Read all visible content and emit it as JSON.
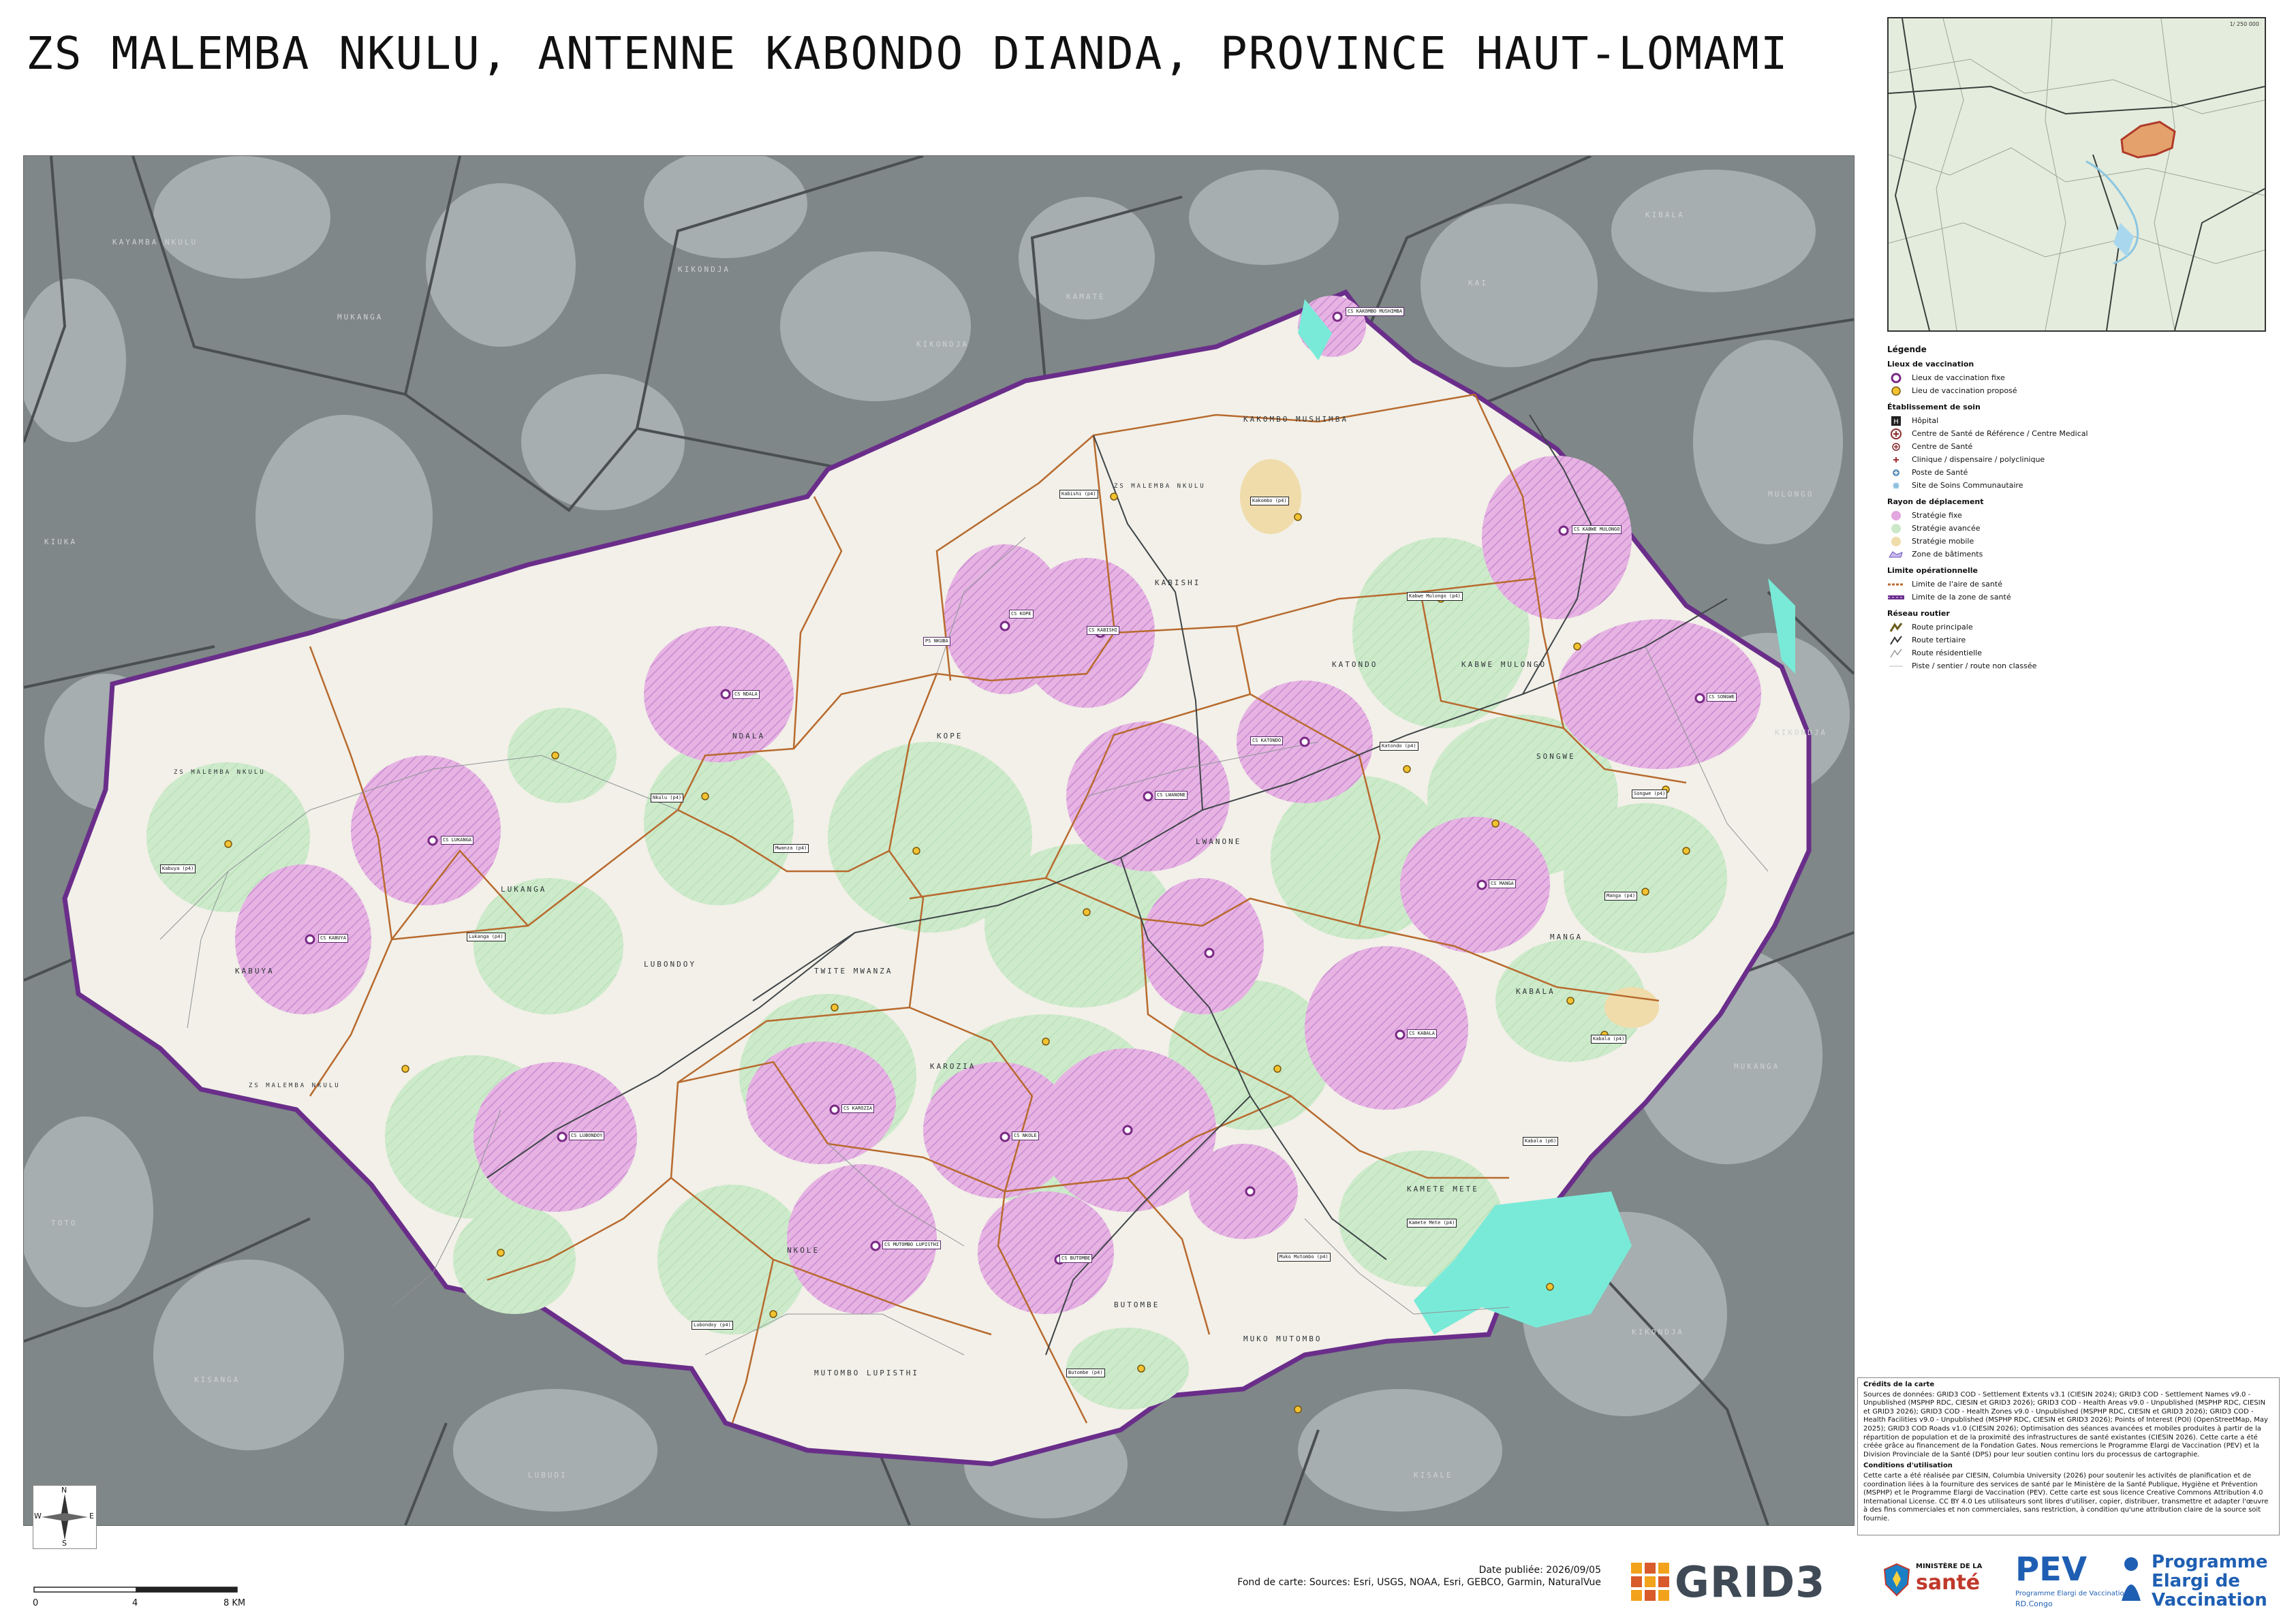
{
  "title": "ZS MALEMBA NKULU, ANTENNE KABONDO DIANDA, PROVINCE HAUT-LOMAMI",
  "colors": {
    "outside": "#7f8788",
    "settlement_outside": "#a9b1b3",
    "zone_bg": "#f1efe6",
    "fixed": "#e3a8df",
    "advanced": "#cbe9c9",
    "mobile": "#f0dcab",
    "water": "#79ead8",
    "boundary_area": "#b86a2e",
    "boundary_zone": "#6a2e8a"
  },
  "map": {
    "outside_labels": [
      "KAYAMBA NKULU",
      "MUKANGA",
      "KIKONDJA",
      "KIKONDJA",
      "KAMATE",
      "KIBALA",
      "MULONGO",
      "KIKONDJA",
      "MUKANGA",
      "KIKONDJA",
      "KISALE",
      "LUBUDI",
      "KISANGA",
      "TOTO",
      "KIUKA",
      "KAI"
    ],
    "aire_labels": [
      "KAKOMBO MUSHIMBA",
      "KABISHI",
      "KATONDO",
      "KABWE MULONGO",
      "SONGWE",
      "LWANONE",
      "MANGA",
      "KABALA",
      "NDALA",
      "KOPE",
      "LUKANGA",
      "KABUYA",
      "LUBONDOY",
      "TWITE MWANZA",
      "KAROZIA",
      "NKOLE",
      "BUTOMBE",
      "MUKO MUTOMBO",
      "KAMETE METE",
      "MUTOMBO LUPISTHI"
    ],
    "zone_boundary_labels": [
      "ZS MALEMBA NKULU",
      "ZS MALEMBA NKULU",
      "ZS MALEMBA NKULU"
    ],
    "sites": [
      {
        "label": "CS KAKOMBO MUSHIMBA",
        "kind": "fix"
      },
      {
        "label": "Kakombo (p4)",
        "kind": "adv"
      },
      {
        "label": "Kabishi (p4)",
        "kind": "adv"
      },
      {
        "label": "CS KABISHI",
        "kind": "fix"
      },
      {
        "label": "PS NKUBA",
        "kind": "fix"
      },
      {
        "label": "CS KOPE",
        "kind": "fix"
      },
      {
        "label": "CS NDALA",
        "kind": "fix"
      },
      {
        "label": "CS LUKANGA",
        "kind": "fix"
      },
      {
        "label": "CS KABUYA",
        "kind": "fix"
      },
      {
        "label": "CS KATONDO",
        "kind": "fix"
      },
      {
        "label": "CS LWANONE",
        "kind": "fix"
      },
      {
        "label": "CS MANGA",
        "kind": "fix"
      },
      {
        "label": "CS KABALA",
        "kind": "fix"
      },
      {
        "label": "CS LUBONDOY",
        "kind": "fix"
      },
      {
        "label": "CS KAROZIA",
        "kind": "fix"
      },
      {
        "label": "CS NKOLE",
        "kind": "fix"
      },
      {
        "label": "CS BUTOMBE",
        "kind": "fix"
      },
      {
        "label": "CS MUTOMBO LUPISTHI",
        "kind": "fix"
      },
      {
        "label": "CS SONGWE",
        "kind": "fix"
      },
      {
        "label": "CS KABWE MULONGO",
        "kind": "fix"
      },
      {
        "label": "Kabwe Mulongo (p4)",
        "kind": "adv"
      },
      {
        "label": "Nkulu (p4)",
        "kind": "adv"
      },
      {
        "label": "Kabuya (p4)",
        "kind": "adv"
      },
      {
        "label": "Lukanga (p4)",
        "kind": "adv"
      },
      {
        "label": "Mwanza (p4)",
        "kind": "adv"
      },
      {
        "label": "Songwe (p4)",
        "kind": "adv"
      },
      {
        "label": "Manga (p4)",
        "kind": "adv"
      },
      {
        "label": "Kabala (p4)",
        "kind": "adv"
      },
      {
        "label": "Kamete Mete (p4)",
        "kind": "adv"
      },
      {
        "label": "Muko Mutombo (p4)",
        "kind": "adv"
      },
      {
        "label": "Butombe (p4)",
        "kind": "adv"
      },
      {
        "label": "Lubondoy (p4)",
        "kind": "adv"
      },
      {
        "label": "Katondo (p4)",
        "kind": "adv"
      },
      {
        "label": "Kabala (p6)",
        "kind": "adv"
      }
    ]
  },
  "inset": {
    "scale": "1/ 250 000"
  },
  "legend": {
    "title": "Légende",
    "sections": [
      {
        "title": "Lieux de vaccination",
        "items": [
          {
            "label": "Lieux de vaccination fixe",
            "icon": "fixed-site-icon"
          },
          {
            "label": "Lieu de vaccination proposé",
            "icon": "proposed-site-icon"
          }
        ]
      },
      {
        "title": "Établissement de soin",
        "items": [
          {
            "label": "Hôpital",
            "icon": "hospital-icon"
          },
          {
            "label": "Centre de Santé de Référence / Centre Medical",
            "icon": "reference-center-icon"
          },
          {
            "label": "Centre de Santé",
            "icon": "health-center-icon"
          },
          {
            "label": "Clinique / dispensaire / polyclinique",
            "icon": "clinic-icon"
          },
          {
            "label": "Poste de Santé",
            "icon": "health-post-icon"
          },
          {
            "label": "Site de Soins Communautaire",
            "icon": "community-site-icon"
          }
        ]
      },
      {
        "title": "Rayon de déplacement",
        "items": [
          {
            "label": "Stratégie fixe",
            "icon": "fixed-strategy-icon"
          },
          {
            "label": "Stratégie avancée",
            "icon": "advanced-strategy-icon"
          },
          {
            "label": "Stratégie mobile",
            "icon": "mobile-strategy-icon"
          },
          {
            "label": "Zone de bâtiments",
            "icon": "buildings-zone-icon"
          }
        ]
      },
      {
        "title": "Limite opérationnelle",
        "items": [
          {
            "label": "Limite de l'aire de santé",
            "icon": "health-area-limit-icon"
          },
          {
            "label": "Limite de la zone de santé",
            "icon": "health-zone-limit-icon"
          }
        ]
      },
      {
        "title": "Réseau routier",
        "items": [
          {
            "label": "Route principale",
            "icon": "main-road-icon"
          },
          {
            "label": "Route tertiaire",
            "icon": "tertiary-road-icon"
          },
          {
            "label": "Route résidentielle",
            "icon": "residential-road-icon"
          },
          {
            "label": "Piste / sentier / route non classée",
            "icon": "track-icon"
          }
        ]
      }
    ]
  },
  "credits": {
    "title": "Crédits de la carte",
    "text": "Sources de données: GRID3 COD - Settlement Extents v3.1 (CIESIN 2024); GRID3 COD - Settlement Names v9.0 - Unpublished (MSPHP RDC, CIESIN et GRID3 2026); GRID3 COD - Health Areas v9.0 - Unpublished (MSPHP RDC, CIESIN et GRID3 2026); GRID3 COD - Health Zones v9.0 - Unpublished (MSPHP RDC, CIESIN et GRID3 2026); GRID3 COD - Health Facilities v9.0 - Unpublished (MSPHP RDC, CIESIN et GRID3 2026); Points of Interest (POI) (OpenStreetMap, May 2025); GRID3 COD Roads v1.0 (CIESIN 2026); Optimisation des séances avancées et mobiles produites à partir de la répartition de population et de la proximité des infrastructures de santé existantes (CIESIN 2026). Cette carte a été créée grâce au financement de la Fondation Gates. Nous remercions le Programme Elargi de Vaccination (PEV) et la Division Provinciale de la Santé (DPS) pour leur soutien continu lors du processus de cartographie.",
    "terms_title": "Conditions d'utilisation",
    "terms": "Cette carte a été réalisée par CIESIN, Columbia University (2026) pour soutenir les activités de planification et de coordination liées à la fourniture des services de santé par le Ministère de la Santé Publique, Hygiène et Prévention (MSPHP) et le Programme Elargi de Vaccination (PEV). Cette carte est sous licence Creative Commons Attribution 4.0 International License. CC BY 4.0 Les utilisateurs sont libres d'utiliser, copier, distribuer, transmettre et adapter l'œuvre à des fins commerciales et non commerciales, sans restriction, à condition qu'une attribution claire de la source soit fournie."
  },
  "north_arrow": {
    "n": "N",
    "s": "S",
    "e": "E",
    "w": "W"
  },
  "scalebar": {
    "zero": "0",
    "mid": "4",
    "end": "8 KM"
  },
  "date": "Date publiée: 2026/09/05",
  "basemap": "Fond de carte: Sources: Esri, USGS, NOAA, Esri, GEBCO, Garmin, NaturalVue",
  "logos": {
    "grid3": "GRID3",
    "ministere_top": "MINISTÈRE DE LA",
    "ministere_main": "santé",
    "pev_main": "PEV",
    "pev_sub": "Programme Elargi de Vaccination",
    "pev_country": "RD.Congo",
    "programme": "Programme",
    "elargi": "Elargi de",
    "vaccination": "Vaccination"
  }
}
